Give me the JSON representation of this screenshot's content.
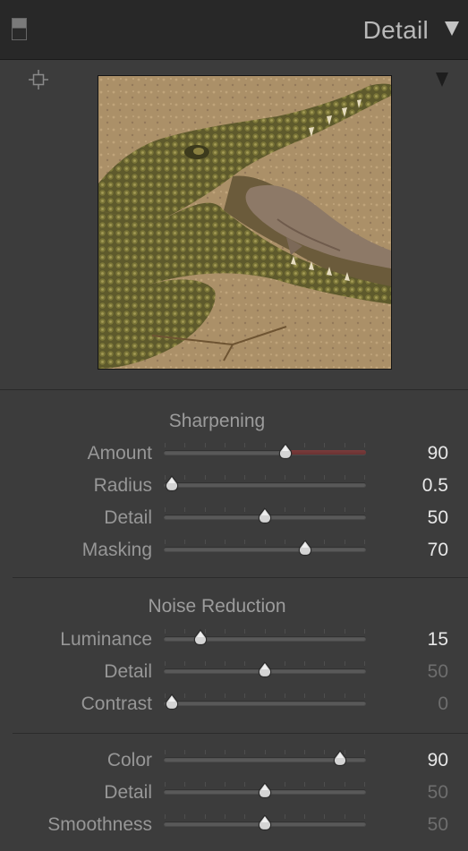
{
  "panel": {
    "title": "Detail"
  },
  "sharpening": {
    "title": "Sharpening",
    "sliders": [
      {
        "label": "Amount",
        "value": "90",
        "fraction": 0.6,
        "dim": false,
        "red_fill_start": 0.6
      },
      {
        "label": "Radius",
        "value": "0.5",
        "fraction": 0.04,
        "dim": false
      },
      {
        "label": "Detail",
        "value": "50",
        "fraction": 0.5,
        "dim": false
      },
      {
        "label": "Masking",
        "value": "70",
        "fraction": 0.7,
        "dim": false
      }
    ]
  },
  "noise_reduction": {
    "title": "Noise Reduction",
    "luminance_sliders": [
      {
        "label": "Luminance",
        "value": "15",
        "fraction": 0.18,
        "dim": false
      },
      {
        "label": "Detail",
        "value": "50",
        "fraction": 0.5,
        "dim": true
      },
      {
        "label": "Contrast",
        "value": "0",
        "fraction": 0.04,
        "dim": true
      }
    ],
    "color_sliders": [
      {
        "label": "Color",
        "value": "90",
        "fraction": 0.87,
        "dim": false
      },
      {
        "label": "Detail",
        "value": "50",
        "fraction": 0.5,
        "dim": true
      },
      {
        "label": "Smoothness",
        "value": "50",
        "fraction": 0.5,
        "dim": true
      }
    ]
  },
  "colors": {
    "panel_bg": "#3c3c3c",
    "header_bg": "#282828",
    "value_text": "#e8e8e8",
    "value_dim": "#6e6e6e",
    "amount_fill": "#7a3c3c"
  },
  "icons": {
    "panel_toggle": "panel-toggle-icon",
    "collapse": "collapse-triangle-icon",
    "target": "target-crosshair-icon",
    "preview_menu": "preview-menu-triangle-icon",
    "slider_thumb": "slider-thumb-icon"
  }
}
